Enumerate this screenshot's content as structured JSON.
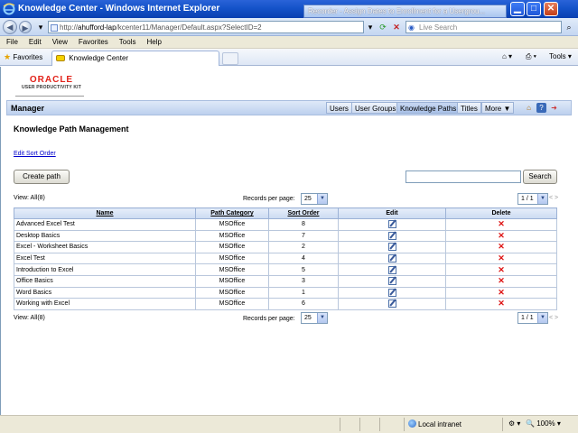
{
  "window": {
    "title": "Knowledge Center - Windows Internet Explorer",
    "recorder_popup": "Recorder - Assign Dates to Enrollment for a Usergrou..."
  },
  "browser": {
    "address_prefix": "http://",
    "address_host": "ahufford-lap",
    "address_path": "/kcenter11/Manager/Default.aspx?SelectID=2",
    "live_search_placeholder": "Live Search",
    "menu": [
      "File",
      "Edit",
      "View",
      "Favorites",
      "Tools",
      "Help"
    ],
    "favorites_label": "Favorites",
    "tab_title": "Knowledge Center",
    "tools_label": "Tools"
  },
  "app": {
    "logo_brand": "ORACLE",
    "logo_product": "USER PRODUCTIVITY KIT",
    "section": "Manager",
    "nav_tabs": [
      {
        "label": "Users"
      },
      {
        "label": "User Groups"
      },
      {
        "label": "Knowledge Paths"
      },
      {
        "label": "Titles"
      },
      {
        "label": "More ▼"
      }
    ],
    "page_title": "Knowledge Path Management",
    "edit_sort_link": "Edit Sort Order",
    "create_button": "Create path",
    "search_button": "Search",
    "view_all": "View: All(8)",
    "records_per_page_label": "Records per page:",
    "records_per_page_value": "25",
    "page_indicator": "1 / 1",
    "pager_arrows": "< >",
    "table": {
      "headers": [
        "Name",
        "Path Category",
        "Sort Order",
        "Edit",
        "Delete"
      ],
      "rows": [
        {
          "name": "Advanced Excel Test",
          "category": "MSOffice",
          "sort": "8"
        },
        {
          "name": "Desktop Basics",
          "category": "MSOffice",
          "sort": "7"
        },
        {
          "name": "Excel - Worksheet Basics",
          "category": "MSOffice",
          "sort": "2"
        },
        {
          "name": "Excel Test",
          "category": "MSOffice",
          "sort": "4"
        },
        {
          "name": "Introduction to Excel",
          "category": "MSOffice",
          "sort": "5"
        },
        {
          "name": "Office Basics",
          "category": "MSOffice",
          "sort": "3"
        },
        {
          "name": "Word Basics",
          "category": "MSOffice",
          "sort": "1"
        },
        {
          "name": "Working with Excel",
          "category": "MSOffice",
          "sort": "6"
        }
      ]
    }
  },
  "status": {
    "zone": "Local intranet",
    "zoom": "100%"
  }
}
